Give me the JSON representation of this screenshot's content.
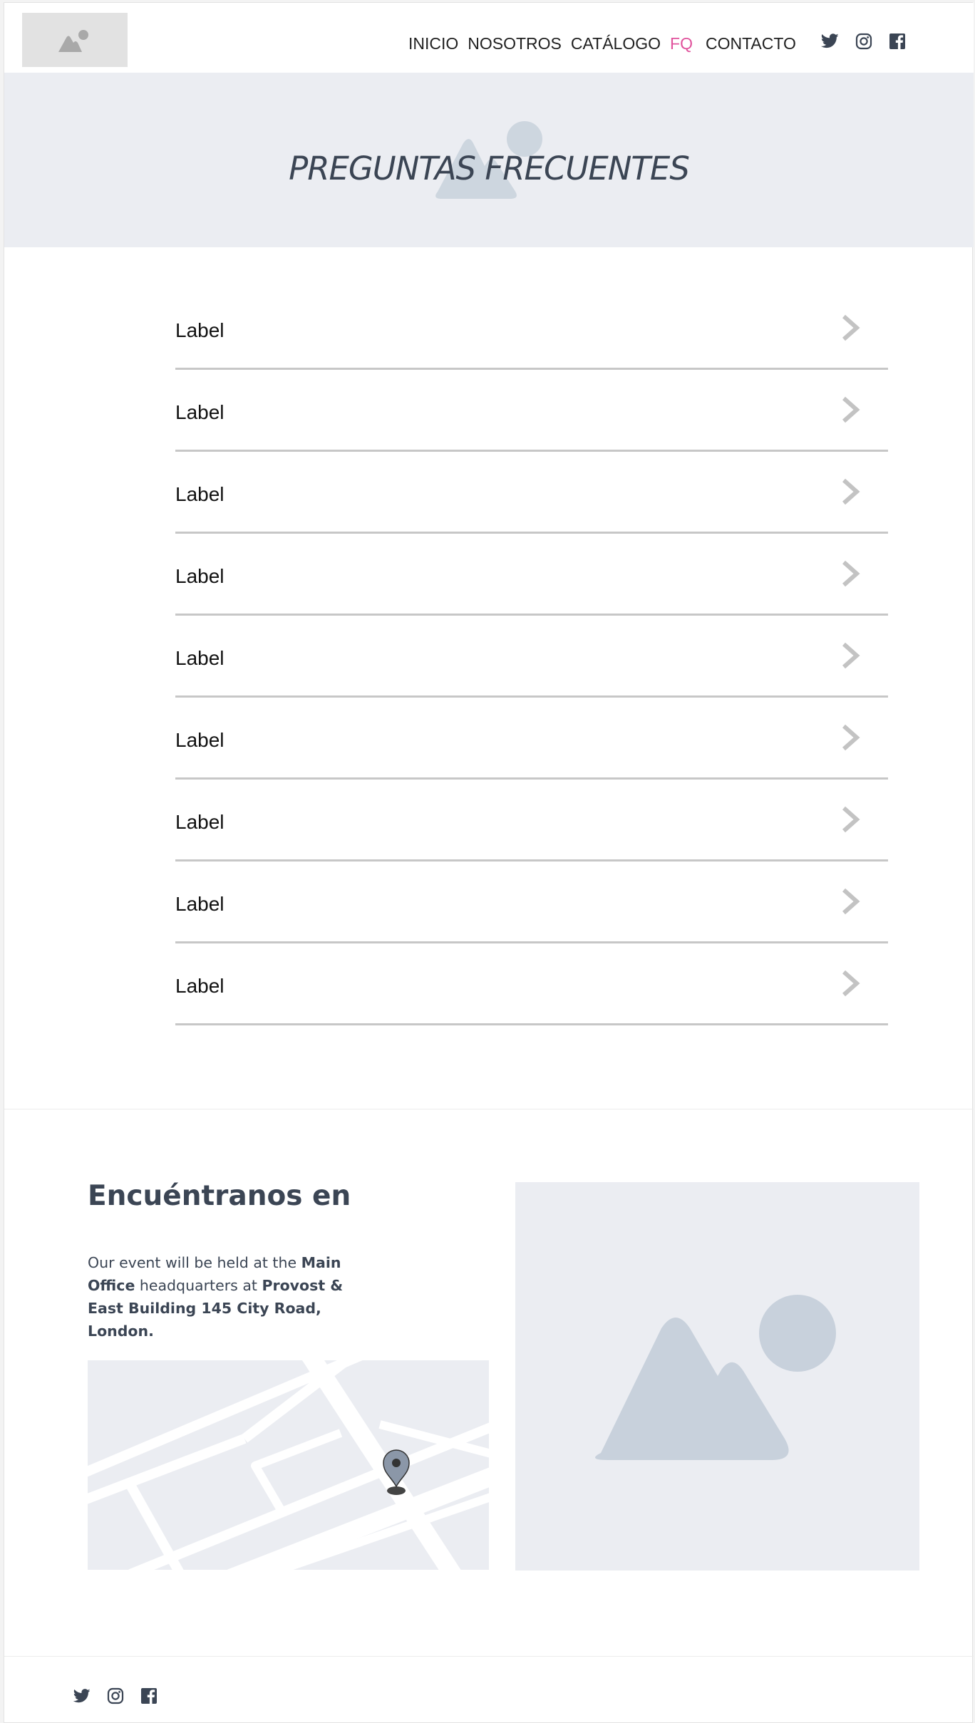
{
  "nav": {
    "items": [
      "INICIO",
      "NOSOTROS",
      "CATÁLOGO",
      "FQ",
      "CONTACTO"
    ],
    "active": "FQ"
  },
  "social": [
    "twitter-icon",
    "instagram-icon",
    "facebook-icon"
  ],
  "hero": {
    "title": "PREGUNTAS FRECUENTES"
  },
  "faq": {
    "items": [
      "Label",
      "Label",
      "Label",
      "Label",
      "Label",
      "Label",
      "Label",
      "Label",
      "Label"
    ]
  },
  "find": {
    "title": "Encuéntranos en",
    "text_1": "Our event will be held at the ",
    "bold_1": "Main Office",
    "text_2": " headquarters at ",
    "bold_2": "Provost & East Building 145 City Road, London."
  },
  "colors": {
    "accent": "#e0529c",
    "heading": "#3b4554",
    "placeholder_bg": "#ebedf2",
    "placeholder_shape": "#c8d1dc",
    "chevron": "#c3c3c3"
  }
}
